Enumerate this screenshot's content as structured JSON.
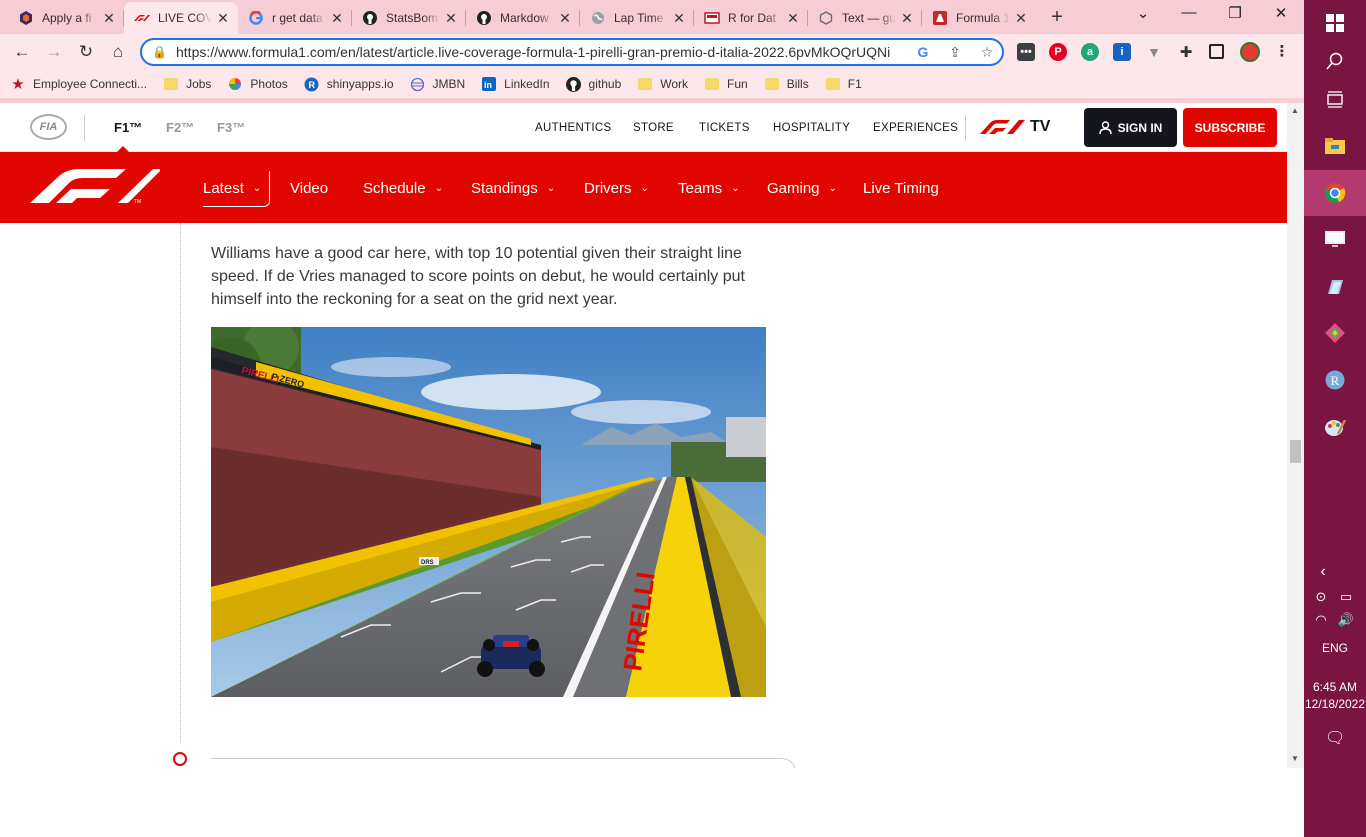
{
  "browser": {
    "tabs": [
      {
        "title": "Apply a fi",
        "icon": "hexagon-favicon"
      },
      {
        "title": "LIVE COV",
        "icon": "f1-favicon",
        "active": true
      },
      {
        "title": "r get data",
        "icon": "google-favicon"
      },
      {
        "title": "StatsBom",
        "icon": "github-favicon"
      },
      {
        "title": "Markdow",
        "icon": "github-favicon"
      },
      {
        "title": "Lap Time",
        "icon": "globe-favicon"
      },
      {
        "title": "R for Dat",
        "icon": "book-favicon"
      },
      {
        "title": "Text — gu",
        "icon": "hexagon-outline-favicon"
      },
      {
        "title": "Formula 1",
        "icon": "formula1-favicon"
      }
    ],
    "new_tab": "+",
    "url": "https://www.formula1.com/en/latest/article.live-coverage-formula-1-pirelli-gran-premio-d-italia-2022.6pvMkOQrUQNi",
    "bookmarks": [
      {
        "label": "Employee Connecti...",
        "icon": "star-icon"
      },
      {
        "label": "Jobs",
        "icon": "folder-icon"
      },
      {
        "label": "Photos",
        "icon": "pinwheel-icon"
      },
      {
        "label": "shinyapps.io",
        "icon": "r-logo-icon"
      },
      {
        "label": "JMBN",
        "icon": "globe-icon"
      },
      {
        "label": "LinkedIn",
        "icon": "linkedin-icon"
      },
      {
        "label": "github",
        "icon": "github-icon"
      },
      {
        "label": "Work",
        "icon": "folder-icon"
      },
      {
        "label": "Fun",
        "icon": "folder-icon"
      },
      {
        "label": "Bills",
        "icon": "folder-icon"
      },
      {
        "label": "F1",
        "icon": "folder-icon"
      }
    ]
  },
  "site": {
    "fia": "FIA",
    "series": [
      "F1™",
      "F2™",
      "F3™"
    ],
    "top_links": [
      "AUTHENTICS",
      "STORE",
      "TICKETS",
      "HOSPITALITY",
      "EXPERIENCES"
    ],
    "f1tv": "TV",
    "sign_in": "SIGN IN",
    "subscribe": "SUBSCRIBE",
    "main_nav": [
      {
        "label": "Latest",
        "dropdown": true
      },
      {
        "label": "Video",
        "dropdown": false
      },
      {
        "label": "Schedule",
        "dropdown": true
      },
      {
        "label": "Standings",
        "dropdown": true
      },
      {
        "label": "Drivers",
        "dropdown": true
      },
      {
        "label": "Teams",
        "dropdown": true
      },
      {
        "label": "Gaming",
        "dropdown": true
      },
      {
        "label": "Live Timing",
        "dropdown": false
      }
    ],
    "brand_red": "#e10600",
    "brand_dark": "#15151e"
  },
  "article": {
    "paragraph": "Williams have a good car here, with top 10 potential given their straight line speed. If de Vries managed to score points on debut, he would certainly put himself into the reckoning for a seat on the grid next year.",
    "photo_signage": [
      "P ZERO",
      "PIRELLI",
      "DRS"
    ]
  },
  "taskbar": {
    "lang": "ENG",
    "time": "6:45 AM",
    "date": "12/18/2022"
  }
}
